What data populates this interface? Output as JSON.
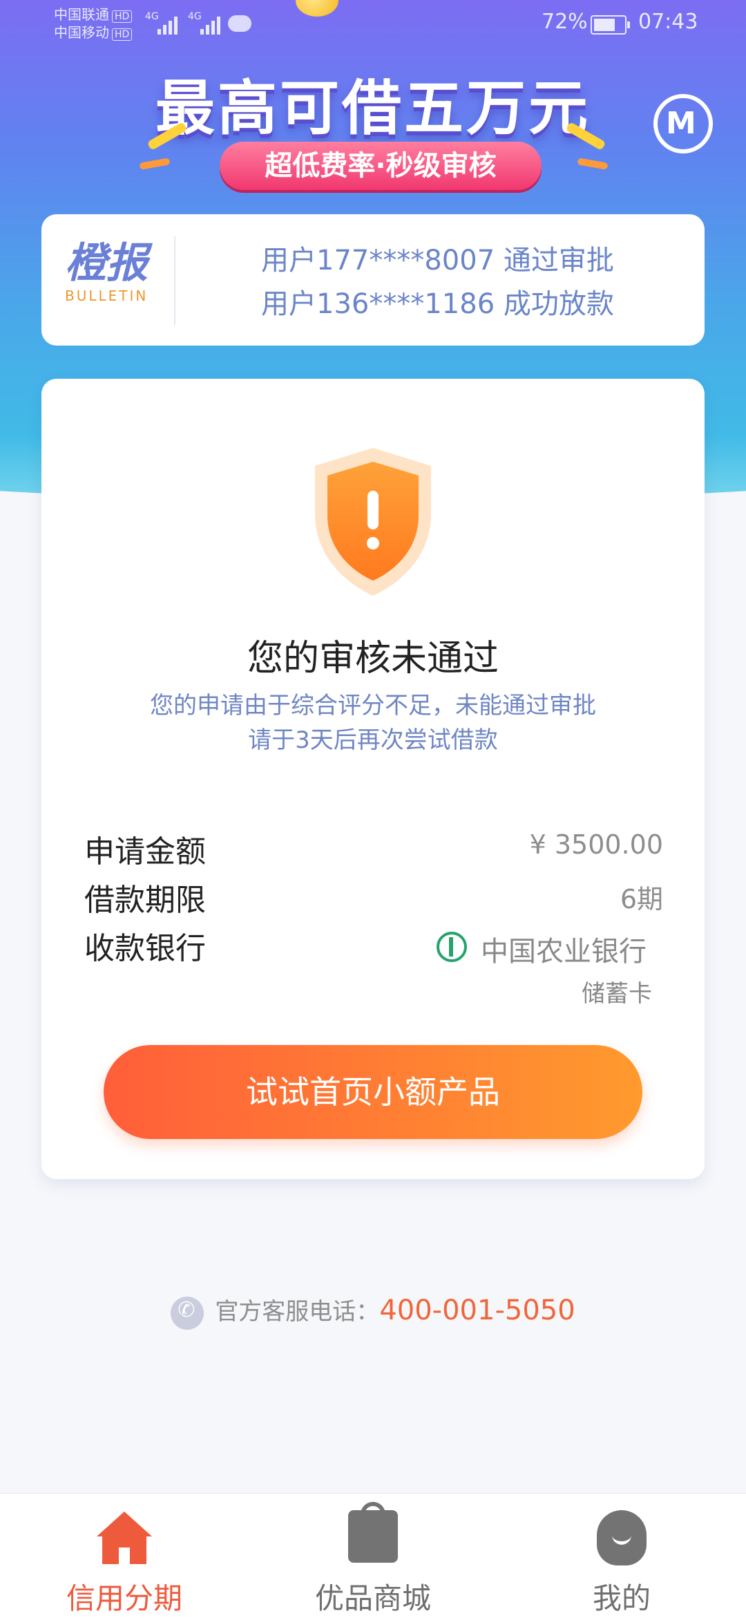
{
  "status_bar": {
    "carrier1": "中国联通",
    "carrier2": "中国移动",
    "hd": "HD",
    "network": "4G",
    "battery_percent": "72%",
    "time": "07:43"
  },
  "banner": {
    "title": "最高可借五万元",
    "subtitle": "超低费率·秒级审核",
    "logo_icon": "m-logo-icon"
  },
  "bulletin": {
    "logo_cn": "橙报",
    "logo_en": "BULLETIN",
    "lines": [
      "用户177****8007 通过审批",
      "用户136****1186 成功放款"
    ]
  },
  "result": {
    "icon": "shield-warning-icon",
    "title": "您的审核未通过",
    "desc_line1": "您的申请由于综合评分不足，未能通过审批",
    "desc_line2": "请于3天后再次尝试借款",
    "rows": [
      {
        "label": "申请金额",
        "value": "¥ 3500.00"
      },
      {
        "label": "借款期限",
        "value": "6期"
      },
      {
        "label": "收款银行",
        "bank": "中国农业银行",
        "card_type": "储蓄卡"
      }
    ],
    "cta": "试试首页小额产品"
  },
  "hotline": {
    "label": "官方客服电话：",
    "number": "400-001-5050"
  },
  "tabs": [
    {
      "label": "信用分期",
      "icon": "home-icon",
      "active": true
    },
    {
      "label": "优品商城",
      "icon": "shopping-bag-icon",
      "active": false
    },
    {
      "label": "我的",
      "icon": "user-icon",
      "active": false
    }
  ],
  "colors": {
    "accent": "#ee5a3c",
    "cta_start": "#ff5e3a",
    "cta_end": "#ff9a2e",
    "hero_top": "#7c6df2",
    "hero_bottom": "#3cc6e6",
    "info_blue": "#6a85c9"
  }
}
